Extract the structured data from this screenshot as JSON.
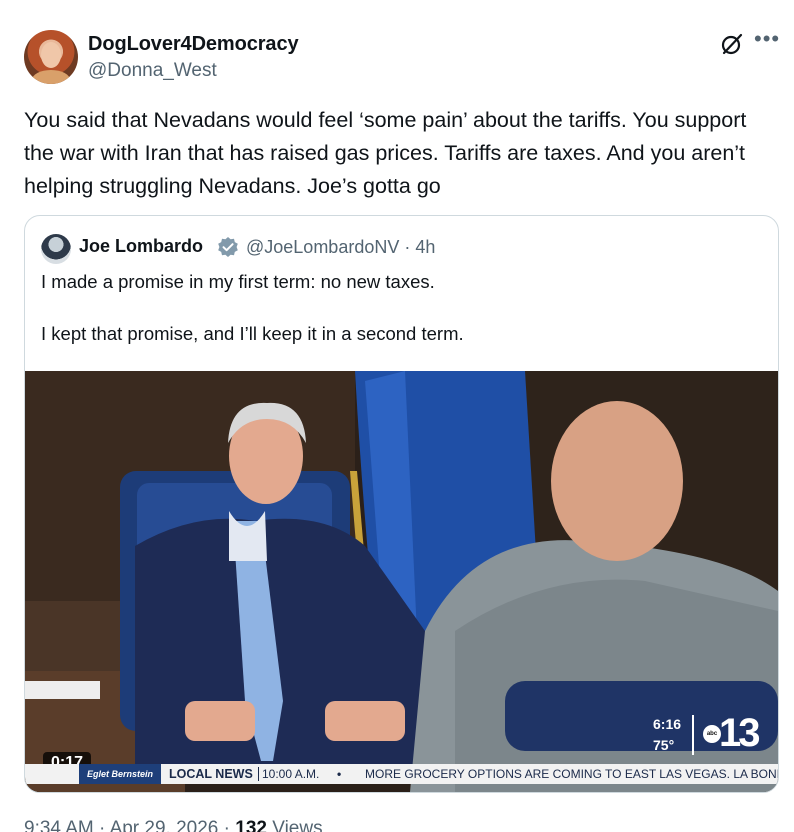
{
  "author": {
    "display_name": "DogLover4Democracy",
    "handle": "@Donna_West"
  },
  "post": {
    "text": "You said that Nevadans would feel ‘some pain’ about the tariffs. You support the war with Iran that has raised gas prices. Tariffs are taxes. And you aren’t helping struggling Nevadans. Joe’s gotta go"
  },
  "header_icons": {
    "grok": "grok-icon",
    "more": "more-icon"
  },
  "quoted": {
    "display_name": "Joe Lombardo",
    "handle": "@JoeLombardoNV",
    "separator": "·",
    "time": "4h",
    "text": "I made a promise in my first term: no new taxes.\n\nI kept that promise, and I’ll keep it in a second term.",
    "video": {
      "duration": "0:17",
      "station_time": "6:16",
      "station_temp": "75°",
      "station_number": "13",
      "station_network": "abc",
      "ticker_brand": "Eglet Bernstein",
      "ticker_section": "LOCAL NEWS",
      "ticker_time": "10:00 A.M.",
      "ticker_bullet": "•",
      "ticker_headline": "MORE GROCERY OPTIONS ARE COMING TO EAST LAS VEGAS. LA BONIT"
    }
  },
  "footer": {
    "time": "9:34 AM",
    "separator": "·",
    "date": "Apr 29, 2026",
    "views_count": "132",
    "views_label": "Views"
  },
  "colors": {
    "text": "#0f1419",
    "secondary": "#536471",
    "border": "#cfd9de",
    "verified": "#829aab"
  }
}
